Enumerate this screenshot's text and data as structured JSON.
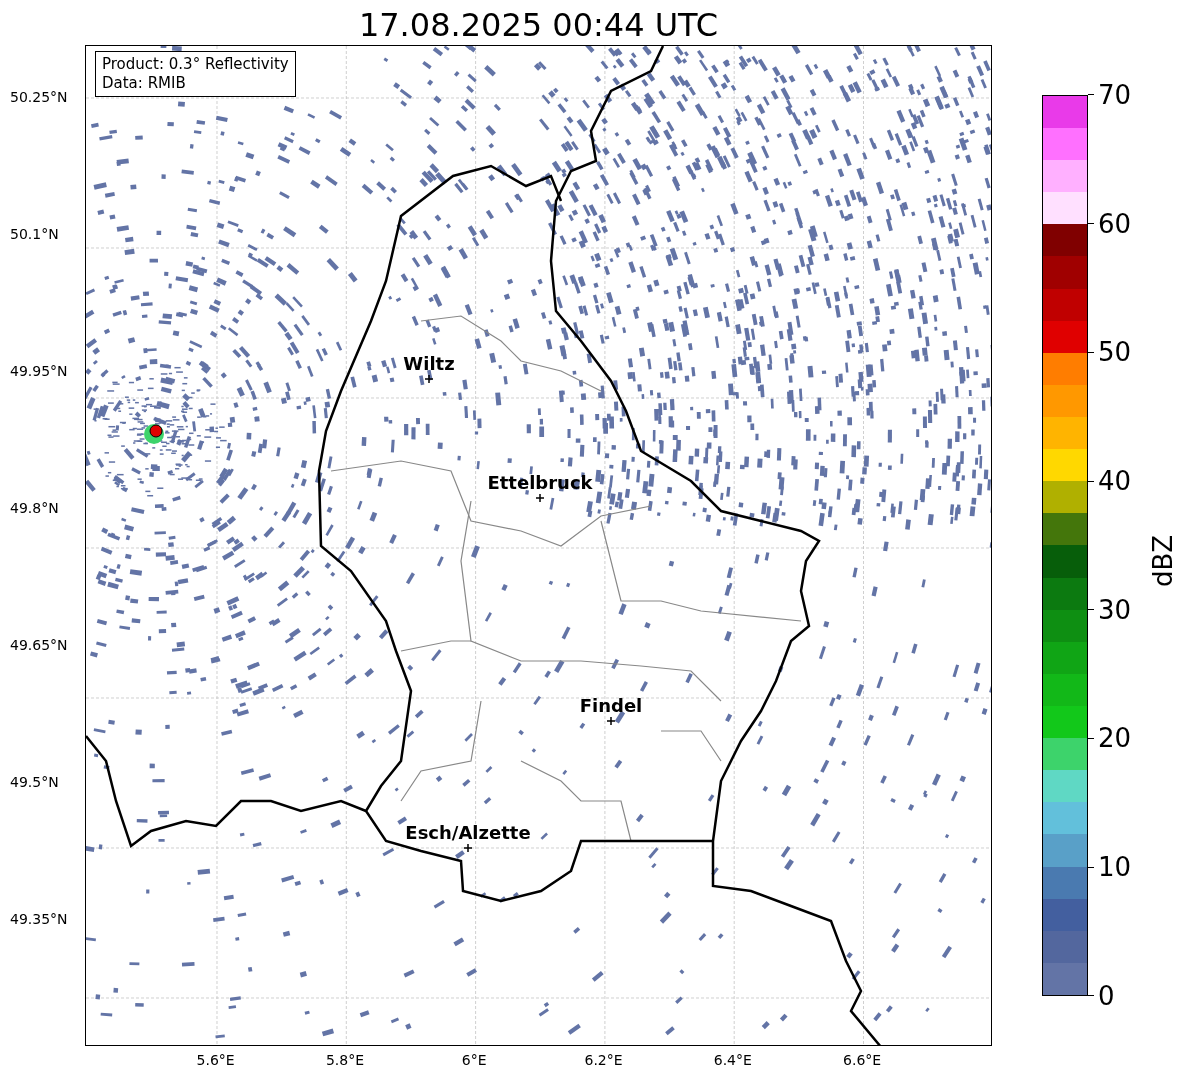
{
  "title": "17.08.2025 00:44 UTC",
  "info_box": {
    "lines": [
      "Product: 0.3° Reflectivity",
      "Data: RMIB"
    ]
  },
  "y_ticks": [
    "50.25°N",
    "50.1°N",
    "49.95°N",
    "49.8°N",
    "49.65°N",
    "49.5°N",
    "49.35°N"
  ],
  "x_ticks": [
    "5.6°E",
    "5.8°E",
    "6°E",
    "6.2°E",
    "6.4°E",
    "6.6°E"
  ],
  "cities": [
    {
      "name": "Wiltz"
    },
    {
      "name": "Ettelbruck"
    },
    {
      "name": "Findel"
    },
    {
      "name": "Esch/Alzette"
    }
  ],
  "colorbar": {
    "label": "dBZ",
    "ticks": [
      "70",
      "60",
      "50",
      "40",
      "30",
      "20",
      "10",
      "0"
    ],
    "segments": [
      {
        "color": "#6374a6"
      },
      {
        "color": "#53679e"
      },
      {
        "color": "#435f9f"
      },
      {
        "color": "#4a7ab0"
      },
      {
        "color": "#59a0c8"
      },
      {
        "color": "#62c0db"
      },
      {
        "color": "#5fd8c4"
      },
      {
        "color": "#3dd36b"
      },
      {
        "color": "#12c81a"
      },
      {
        "color": "#12b818"
      },
      {
        "color": "#10a515"
      },
      {
        "color": "#0e8f12"
      },
      {
        "color": "#0c7a10"
      },
      {
        "color": "#075e0a"
      },
      {
        "color": "#44760b"
      },
      {
        "color": "#b0b000"
      },
      {
        "color": "#ffd800"
      },
      {
        "color": "#ffb400"
      },
      {
        "color": "#ff9800"
      },
      {
        "color": "#ff7d00"
      },
      {
        "color": "#e00000"
      },
      {
        "color": "#c00000"
      },
      {
        "color": "#a00000"
      },
      {
        "color": "#800000"
      },
      {
        "color": "#ffe0ff"
      },
      {
        "color": "#ffb0ff"
      },
      {
        "color": "#ff70ff"
      },
      {
        "color": "#e93ae9"
      }
    ]
  }
}
